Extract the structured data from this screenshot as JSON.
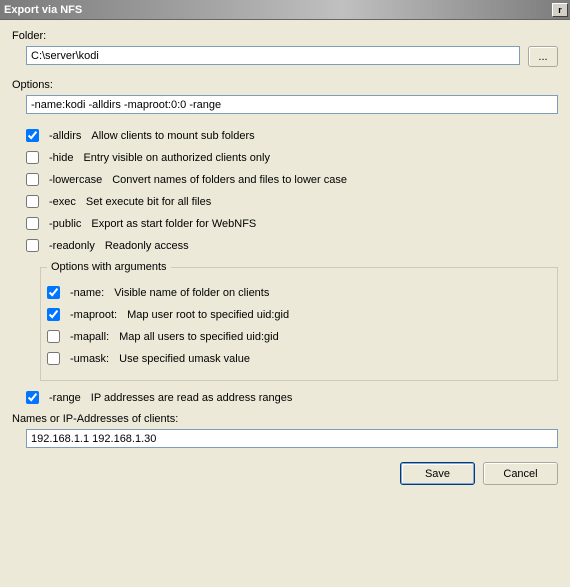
{
  "window": {
    "title": "Export via NFS",
    "close_glyph": "r"
  },
  "folder": {
    "label": "Folder:",
    "value": "C:\\server\\kodi",
    "browse_label": "..."
  },
  "options": {
    "label": "Options:",
    "value": "-name:kodi -alldirs -maproot:0:0 -range",
    "flags": [
      {
        "flag": "-alldirs",
        "desc": "Allow clients to mount sub folders",
        "checked": true
      },
      {
        "flag": "-hide",
        "desc": "Entry visible on authorized clients only",
        "checked": false
      },
      {
        "flag": "-lowercase",
        "desc": "Convert names of folders and files to lower case",
        "checked": false
      },
      {
        "flag": "-exec",
        "desc": "Set execute bit for all files",
        "checked": false
      },
      {
        "flag": "-public",
        "desc": "Export as start folder for WebNFS",
        "checked": false
      },
      {
        "flag": "-readonly",
        "desc": "Readonly access",
        "checked": false
      }
    ],
    "args_legend": "Options with arguments",
    "args": [
      {
        "flag": "-name:",
        "desc": "Visible name of folder on clients",
        "checked": true
      },
      {
        "flag": "-maproot:",
        "desc": "Map user root to specified uid:gid",
        "checked": true
      },
      {
        "flag": "-mapall:",
        "desc": "Map all users to specified uid:gid",
        "checked": false
      },
      {
        "flag": "-umask:",
        "desc": "Use specified umask value",
        "checked": false
      }
    ],
    "range": {
      "flag": "-range",
      "desc": "IP addresses are read as address ranges",
      "checked": true
    }
  },
  "clients": {
    "label": "Names or IP-Addresses of clients:",
    "value": "192.168.1.1 192.168.1.30"
  },
  "buttons": {
    "save": "Save",
    "cancel": "Cancel"
  }
}
